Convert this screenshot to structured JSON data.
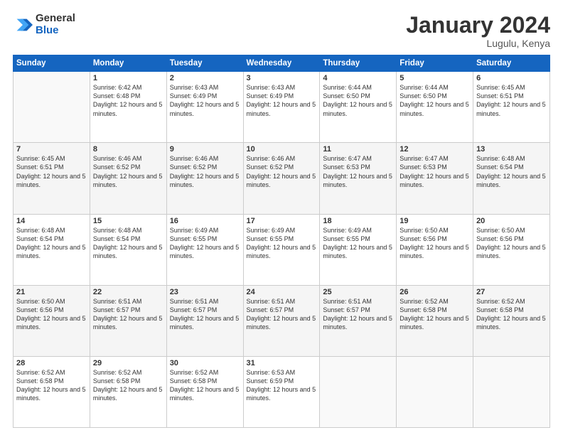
{
  "logo": {
    "general": "General",
    "blue": "Blue"
  },
  "header": {
    "month": "January 2024",
    "location": "Lugulu, Kenya"
  },
  "weekdays": [
    "Sunday",
    "Monday",
    "Tuesday",
    "Wednesday",
    "Thursday",
    "Friday",
    "Saturday"
  ],
  "weeks": [
    [
      {
        "day": "",
        "sunrise": "",
        "sunset": "",
        "daylight": ""
      },
      {
        "day": "1",
        "sunrise": "Sunrise: 6:42 AM",
        "sunset": "Sunset: 6:48 PM",
        "daylight": "Daylight: 12 hours and 5 minutes."
      },
      {
        "day": "2",
        "sunrise": "Sunrise: 6:43 AM",
        "sunset": "Sunset: 6:49 PM",
        "daylight": "Daylight: 12 hours and 5 minutes."
      },
      {
        "day": "3",
        "sunrise": "Sunrise: 6:43 AM",
        "sunset": "Sunset: 6:49 PM",
        "daylight": "Daylight: 12 hours and 5 minutes."
      },
      {
        "day": "4",
        "sunrise": "Sunrise: 6:44 AM",
        "sunset": "Sunset: 6:50 PM",
        "daylight": "Daylight: 12 hours and 5 minutes."
      },
      {
        "day": "5",
        "sunrise": "Sunrise: 6:44 AM",
        "sunset": "Sunset: 6:50 PM",
        "daylight": "Daylight: 12 hours and 5 minutes."
      },
      {
        "day": "6",
        "sunrise": "Sunrise: 6:45 AM",
        "sunset": "Sunset: 6:51 PM",
        "daylight": "Daylight: 12 hours and 5 minutes."
      }
    ],
    [
      {
        "day": "7",
        "sunrise": "Sunrise: 6:45 AM",
        "sunset": "Sunset: 6:51 PM",
        "daylight": "Daylight: 12 hours and 5 minutes."
      },
      {
        "day": "8",
        "sunrise": "Sunrise: 6:46 AM",
        "sunset": "Sunset: 6:52 PM",
        "daylight": "Daylight: 12 hours and 5 minutes."
      },
      {
        "day": "9",
        "sunrise": "Sunrise: 6:46 AM",
        "sunset": "Sunset: 6:52 PM",
        "daylight": "Daylight: 12 hours and 5 minutes."
      },
      {
        "day": "10",
        "sunrise": "Sunrise: 6:46 AM",
        "sunset": "Sunset: 6:52 PM",
        "daylight": "Daylight: 12 hours and 5 minutes."
      },
      {
        "day": "11",
        "sunrise": "Sunrise: 6:47 AM",
        "sunset": "Sunset: 6:53 PM",
        "daylight": "Daylight: 12 hours and 5 minutes."
      },
      {
        "day": "12",
        "sunrise": "Sunrise: 6:47 AM",
        "sunset": "Sunset: 6:53 PM",
        "daylight": "Daylight: 12 hours and 5 minutes."
      },
      {
        "day": "13",
        "sunrise": "Sunrise: 6:48 AM",
        "sunset": "Sunset: 6:54 PM",
        "daylight": "Daylight: 12 hours and 5 minutes."
      }
    ],
    [
      {
        "day": "14",
        "sunrise": "Sunrise: 6:48 AM",
        "sunset": "Sunset: 6:54 PM",
        "daylight": "Daylight: 12 hours and 5 minutes."
      },
      {
        "day": "15",
        "sunrise": "Sunrise: 6:48 AM",
        "sunset": "Sunset: 6:54 PM",
        "daylight": "Daylight: 12 hours and 5 minutes."
      },
      {
        "day": "16",
        "sunrise": "Sunrise: 6:49 AM",
        "sunset": "Sunset: 6:55 PM",
        "daylight": "Daylight: 12 hours and 5 minutes."
      },
      {
        "day": "17",
        "sunrise": "Sunrise: 6:49 AM",
        "sunset": "Sunset: 6:55 PM",
        "daylight": "Daylight: 12 hours and 5 minutes."
      },
      {
        "day": "18",
        "sunrise": "Sunrise: 6:49 AM",
        "sunset": "Sunset: 6:55 PM",
        "daylight": "Daylight: 12 hours and 5 minutes."
      },
      {
        "day": "19",
        "sunrise": "Sunrise: 6:50 AM",
        "sunset": "Sunset: 6:56 PM",
        "daylight": "Daylight: 12 hours and 5 minutes."
      },
      {
        "day": "20",
        "sunrise": "Sunrise: 6:50 AM",
        "sunset": "Sunset: 6:56 PM",
        "daylight": "Daylight: 12 hours and 5 minutes."
      }
    ],
    [
      {
        "day": "21",
        "sunrise": "Sunrise: 6:50 AM",
        "sunset": "Sunset: 6:56 PM",
        "daylight": "Daylight: 12 hours and 5 minutes."
      },
      {
        "day": "22",
        "sunrise": "Sunrise: 6:51 AM",
        "sunset": "Sunset: 6:57 PM",
        "daylight": "Daylight: 12 hours and 5 minutes."
      },
      {
        "day": "23",
        "sunrise": "Sunrise: 6:51 AM",
        "sunset": "Sunset: 6:57 PM",
        "daylight": "Daylight: 12 hours and 5 minutes."
      },
      {
        "day": "24",
        "sunrise": "Sunrise: 6:51 AM",
        "sunset": "Sunset: 6:57 PM",
        "daylight": "Daylight: 12 hours and 5 minutes."
      },
      {
        "day": "25",
        "sunrise": "Sunrise: 6:51 AM",
        "sunset": "Sunset: 6:57 PM",
        "daylight": "Daylight: 12 hours and 5 minutes."
      },
      {
        "day": "26",
        "sunrise": "Sunrise: 6:52 AM",
        "sunset": "Sunset: 6:58 PM",
        "daylight": "Daylight: 12 hours and 5 minutes."
      },
      {
        "day": "27",
        "sunrise": "Sunrise: 6:52 AM",
        "sunset": "Sunset: 6:58 PM",
        "daylight": "Daylight: 12 hours and 5 minutes."
      }
    ],
    [
      {
        "day": "28",
        "sunrise": "Sunrise: 6:52 AM",
        "sunset": "Sunset: 6:58 PM",
        "daylight": "Daylight: 12 hours and 5 minutes."
      },
      {
        "day": "29",
        "sunrise": "Sunrise: 6:52 AM",
        "sunset": "Sunset: 6:58 PM",
        "daylight": "Daylight: 12 hours and 5 minutes."
      },
      {
        "day": "30",
        "sunrise": "Sunrise: 6:52 AM",
        "sunset": "Sunset: 6:58 PM",
        "daylight": "Daylight: 12 hours and 5 minutes."
      },
      {
        "day": "31",
        "sunrise": "Sunrise: 6:53 AM",
        "sunset": "Sunset: 6:59 PM",
        "daylight": "Daylight: 12 hours and 5 minutes."
      },
      {
        "day": "",
        "sunrise": "",
        "sunset": "",
        "daylight": ""
      },
      {
        "day": "",
        "sunrise": "",
        "sunset": "",
        "daylight": ""
      },
      {
        "day": "",
        "sunrise": "",
        "sunset": "",
        "daylight": ""
      }
    ]
  ]
}
